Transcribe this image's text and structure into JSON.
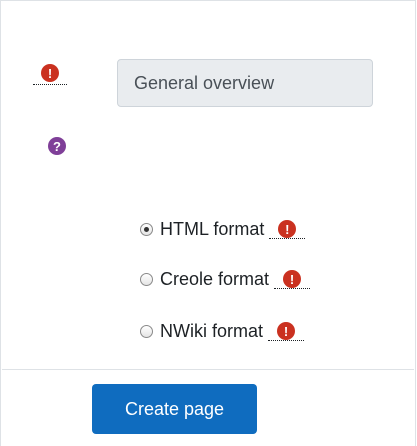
{
  "form": {
    "title_value": "General overview",
    "required_icon_glyph": "!",
    "help_icon_glyph": "?",
    "format_options": [
      {
        "label": "HTML format",
        "selected": true
      },
      {
        "label": "Creole format",
        "selected": false
      },
      {
        "label": "NWiki format",
        "selected": false
      }
    ],
    "submit_label": "Create page"
  },
  "colors": {
    "required": "#ca3120",
    "help": "#7f3f98",
    "primary_button": "#0f6cbf"
  }
}
